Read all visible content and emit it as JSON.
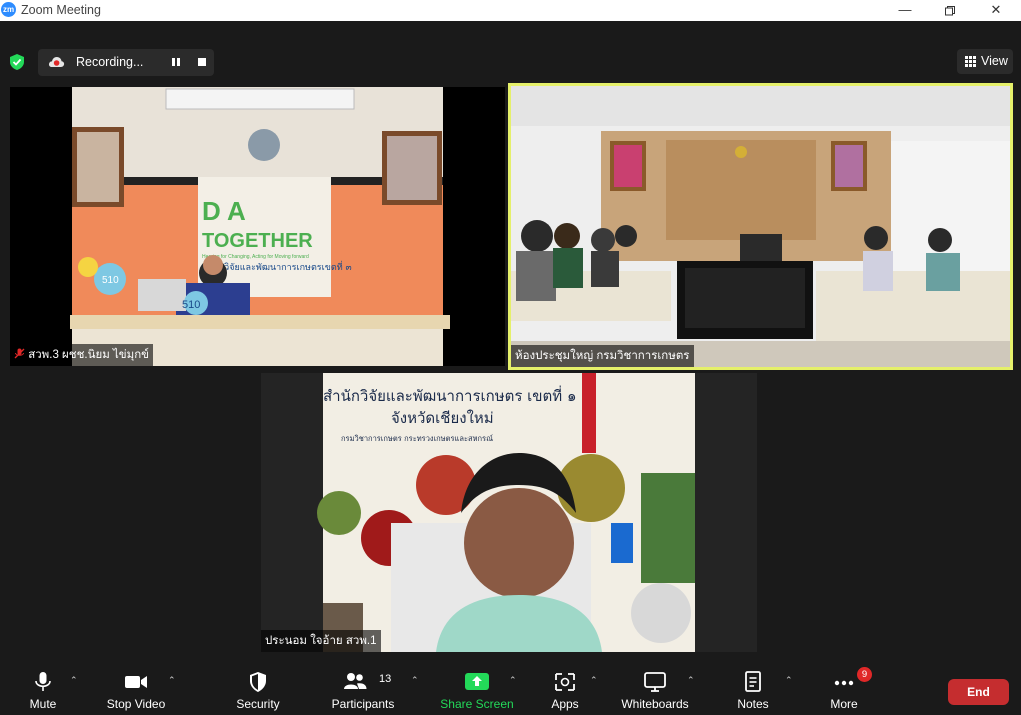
{
  "window": {
    "app_icon": "zm",
    "title": "Zoom Meeting"
  },
  "top": {
    "recording_label": "Recording...",
    "view_label": "View"
  },
  "participants": [
    {
      "name": "สวพ.3 ผชช.นิยม ไข่มุกข์",
      "muted": true
    },
    {
      "name": "ห้องประชุมใหญ่ กรมวิชาการเกษตร",
      "active_speaker": true
    },
    {
      "name": "ประนอม ใจอ้าย สวพ.1"
    }
  ],
  "video_text": {
    "doa_logo": "D A",
    "together": "TOGETHER",
    "tagline": "Hearing for Changing, Acting for Moving forward",
    "office": "สำนักวิจัยและพัฒนาการเกษตรเขตที่ ๓",
    "banner_line1": "สำนักวิจัยและพัฒนาการเกษตร เขตที่ ๑",
    "banner_line2": "จังหวัดเชียงใหม่",
    "banner_line3": "กรมวิชาการเกษตร กระทรวงเกษตรและสหกรณ์",
    "logo_number": "510"
  },
  "toolbar": {
    "mute": "Mute",
    "stop_video": "Stop Video",
    "security": "Security",
    "participants": "Participants",
    "participants_count": "13",
    "share_screen": "Share Screen",
    "apps": "Apps",
    "whiteboards": "Whiteboards",
    "notes": "Notes",
    "more": "More",
    "more_badge": "9",
    "end": "End"
  },
  "colors": {
    "accent": "#2d8cff",
    "active_speaker_border": "#e5f06a",
    "share_green": "#23d959",
    "end_red": "#c52d2f",
    "badge_red": "#e02828"
  }
}
